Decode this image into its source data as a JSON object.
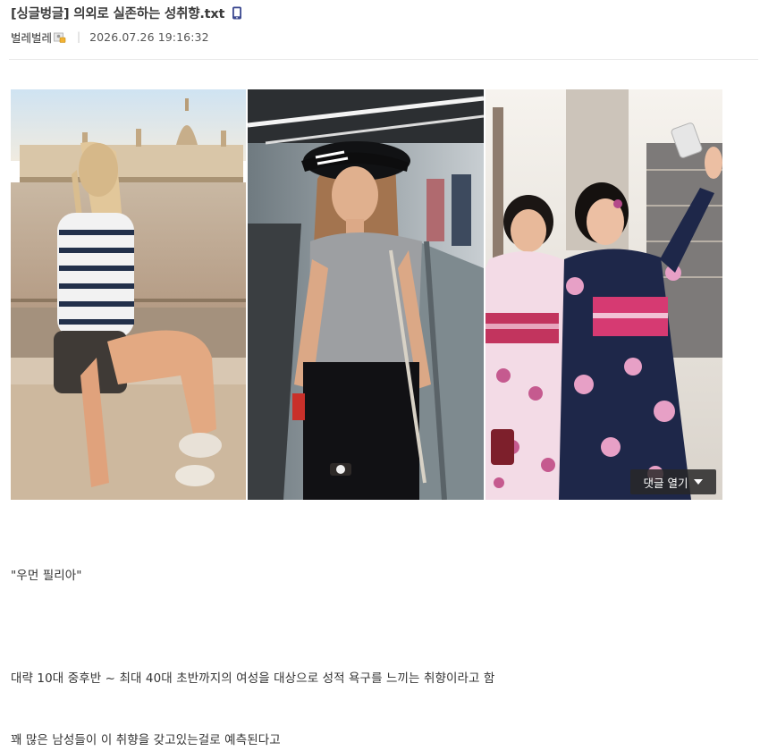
{
  "post": {
    "title": "[싱글벙글] 의외로 실존하는 성취향.txt",
    "author": "벌레벌레",
    "date": "2026.07.26 19:16:32"
  },
  "icons": {
    "mobile": "mobile-phone-icon",
    "member": "fixed-member-icon"
  },
  "comment_button": {
    "label": "댓글 열기"
  },
  "body": {
    "paragraphs": [
      "\"우먼 필리아\"",
      "대략 10대 중후반 ~ 최대 40대 초반까지의 여성을 대상으로 성적 욕구를 느끼는 취향이라고 함",
      "꽤 많은 남성들이 이 취향을 갖고있는걸로 예측된다고"
    ]
  },
  "colors": {
    "accent_blue": "#3b4890",
    "title_text": "#3a3a3a",
    "divider": "#eaeaea"
  }
}
